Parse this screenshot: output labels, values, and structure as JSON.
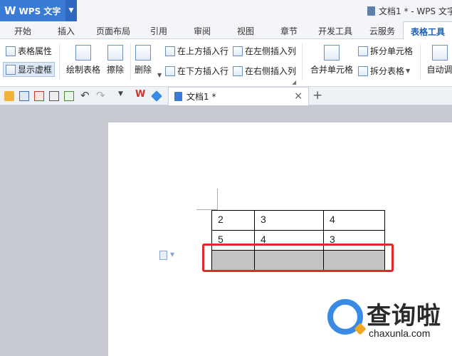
{
  "titlebar": {
    "app_logo": "W",
    "app_name": "WPS 文字",
    "document_title": "文档1 * - WPS 文字"
  },
  "tabs": [
    "开始",
    "插入",
    "页面布局",
    "引用",
    "审阅",
    "视图",
    "章节",
    "开发工具",
    "云服务",
    "表格工具"
  ],
  "active_tab": "表格工具",
  "ribbon": {
    "table_properties": "表格属性",
    "show_gridlines": "显示虚框",
    "draw_table": "绘制表格",
    "eraser": "擦除",
    "delete": "删除",
    "insert_row_above": "在上方插入行",
    "insert_row_below": "在下方插入行",
    "insert_col_left": "在左侧插入列",
    "insert_col_right": "在右侧插入列",
    "merge_cells": "合并单元格",
    "split_cells": "拆分单元格",
    "split_table": "拆分表格",
    "auto_fit": "自动调"
  },
  "doc_tab": {
    "label": "文档1 *",
    "close": "×",
    "new": "+"
  },
  "table": {
    "rows": [
      [
        "2",
        "3",
        "4"
      ],
      [
        "5",
        "4",
        "3"
      ],
      [
        "",
        "",
        ""
      ]
    ]
  },
  "watermark": {
    "brand": "查询啦",
    "url": "chaxunla.com"
  },
  "colors": {
    "accent": "#3a7bd5",
    "highlight": "#e0292a",
    "shaded_row": "#c4c4c4"
  }
}
